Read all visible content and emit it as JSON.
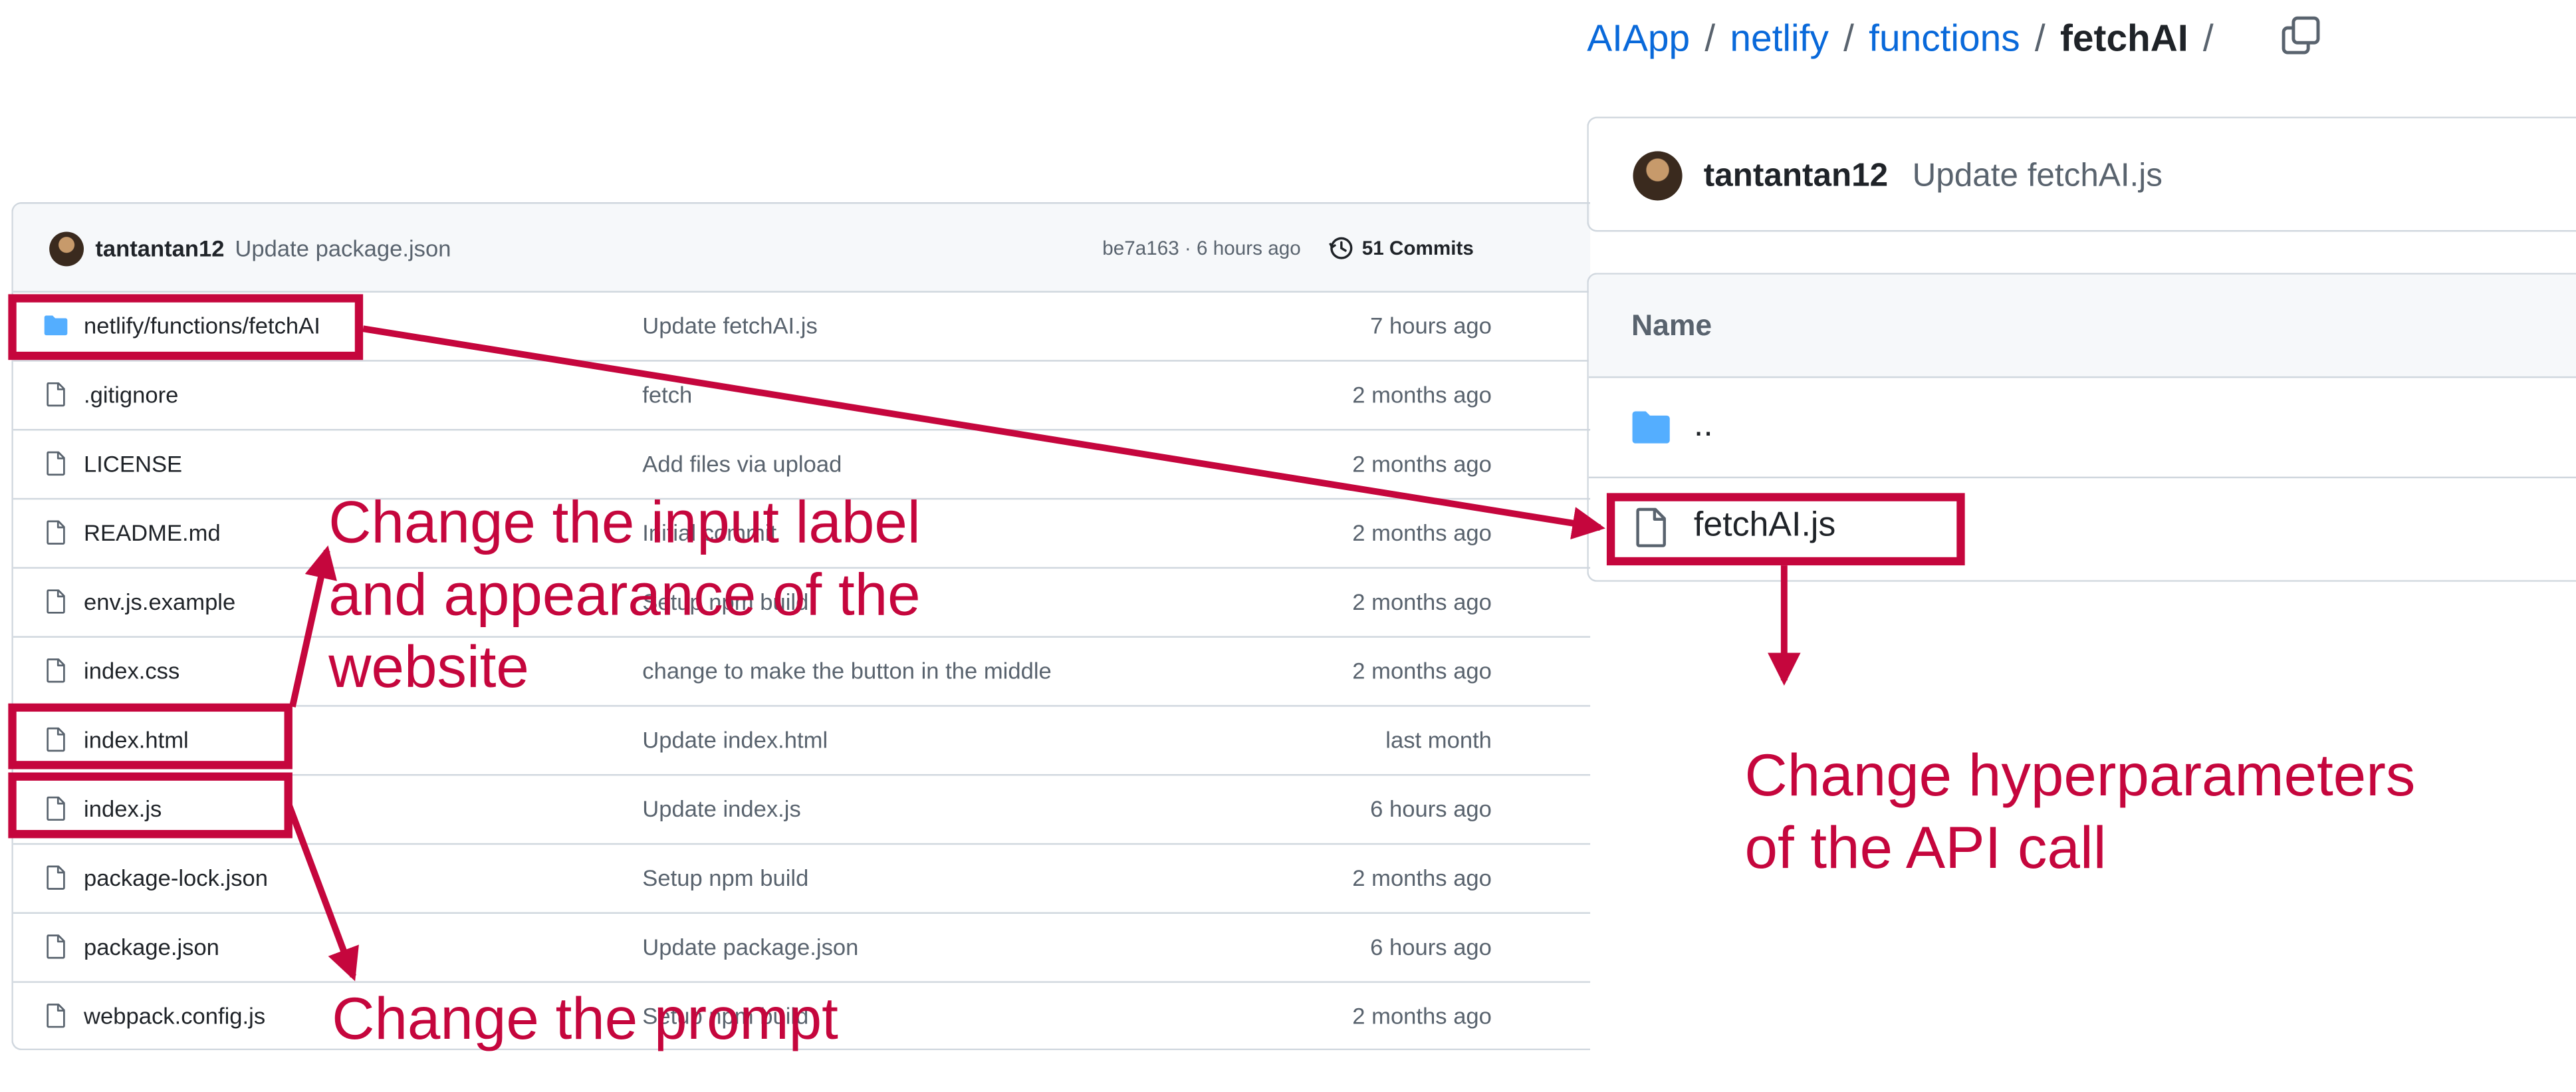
{
  "repo_list": {
    "commit_bar": {
      "author": "tantantan12",
      "message": "Update package.json",
      "hash_time": "be7a163 · 6 hours ago",
      "commits_label": "51 Commits"
    },
    "rows": [
      {
        "icon": "folder-icon",
        "name": "netlify/functions/fetchAI",
        "message": "Update fetchAI.js",
        "time": "7 hours ago"
      },
      {
        "icon": "file-icon",
        "name": ".gitignore",
        "message": "fetch",
        "time": "2 months ago"
      },
      {
        "icon": "file-icon",
        "name": "LICENSE",
        "message": "Add files via upload",
        "time": "2 months ago"
      },
      {
        "icon": "file-icon",
        "name": "README.md",
        "message": "Initial commit",
        "time": "2 months ago"
      },
      {
        "icon": "file-icon",
        "name": "env.js.example",
        "message": "Setup npm build",
        "time": "2 months ago"
      },
      {
        "icon": "file-icon",
        "name": "index.css",
        "message": "change to make the button in the middle",
        "time": "2 months ago"
      },
      {
        "icon": "file-icon",
        "name": "index.html",
        "message": "Update index.html",
        "time": "last month"
      },
      {
        "icon": "file-icon",
        "name": "index.js",
        "message": "Update index.js",
        "time": "6 hours ago"
      },
      {
        "icon": "file-icon",
        "name": "package-lock.json",
        "message": "Setup npm build",
        "time": "2 months ago"
      },
      {
        "icon": "file-icon",
        "name": "package.json",
        "message": "Update package.json",
        "time": "6 hours ago"
      },
      {
        "icon": "file-icon",
        "name": "webpack.config.js",
        "message": "Setup npm build",
        "time": "2 months ago"
      }
    ]
  },
  "folder_view": {
    "breadcrumb": [
      "AIApp",
      "netlify",
      "functions",
      "fetchAI"
    ],
    "breadcrumb_separator": "/",
    "latest_commit": {
      "author": "tantantan12",
      "message": "Update fetchAI.js"
    },
    "table_header": "Name",
    "parent_dir": "..",
    "file": "fetchAI.js"
  },
  "annotations": {
    "color": "#c5063d",
    "note_html": [
      "Change the input label",
      "and appearance of the",
      "website"
    ],
    "note_js": "Change the prompt",
    "note_fetch": [
      "Change hyperparameters",
      "of the API call"
    ]
  },
  "colors": {
    "link": "#0969da",
    "folder": "#54aeff",
    "muted": "#59636e",
    "border": "#d0d7de"
  }
}
